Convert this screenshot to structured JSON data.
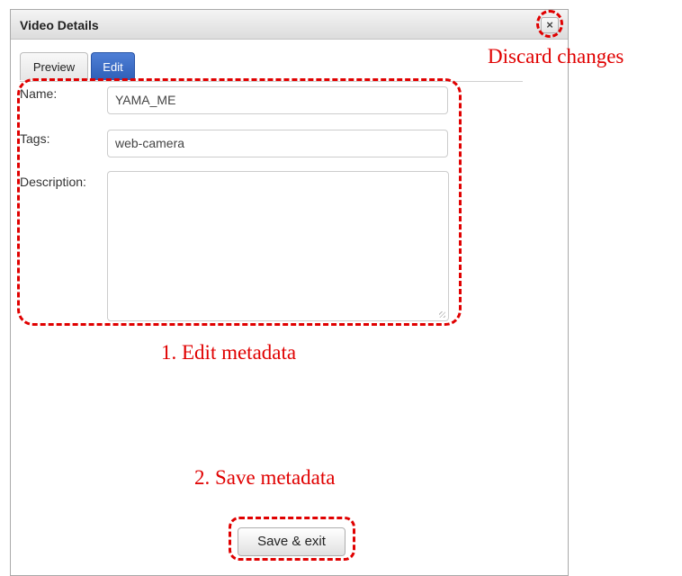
{
  "dialog": {
    "title": "Video Details",
    "close_glyph": "×",
    "tabs": [
      {
        "label": "Preview",
        "active": false
      },
      {
        "label": "Edit",
        "active": true
      }
    ],
    "fields": {
      "name": {
        "label": "Name:",
        "value": "YAMA_ME"
      },
      "tags": {
        "label": "Tags:",
        "value": "web-camera"
      },
      "description": {
        "label": "Description:",
        "value": ""
      }
    },
    "save_label": "Save & exit"
  },
  "annotations": {
    "discard": "Discard changes",
    "edit": "1. Edit metadata",
    "save": "2. Save metadata",
    "color": "#e00000"
  },
  "icons": {
    "close": "close-icon",
    "resize": "resize-grip-icon"
  }
}
